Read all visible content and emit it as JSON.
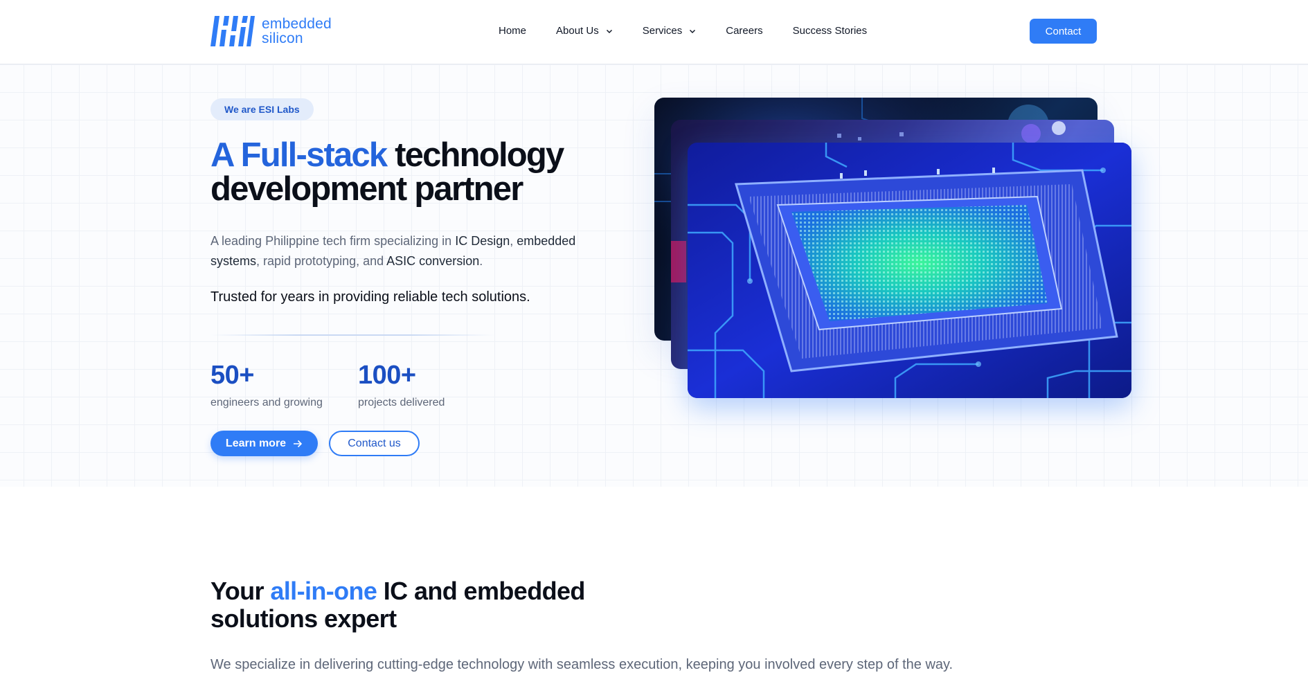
{
  "brand": {
    "name_line1": "embedded",
    "name_line2": "silicon",
    "color": "#2f7cf6"
  },
  "nav": {
    "items": [
      {
        "label": "Home",
        "dropdown": false
      },
      {
        "label": "About Us",
        "dropdown": true
      },
      {
        "label": "Services",
        "dropdown": true
      },
      {
        "label": "Careers",
        "dropdown": false
      },
      {
        "label": "Success Stories",
        "dropdown": false
      }
    ],
    "contact_label": "Contact"
  },
  "hero": {
    "badge": "We are ESI Labs",
    "title_accent": "A Full-stack",
    "title_rest": " technology development partner",
    "lead": {
      "t1": "A leading Philippine tech firm specializing in ",
      "b1": "IC Design",
      "t2": ", ",
      "b2": "embedded systems",
      "t3": ", rapid prototyping, and ",
      "b3": "ASIC conversion",
      "t4": "."
    },
    "trusted": "Trusted for years in providing reliable tech solutions.",
    "stats": [
      {
        "value": "50+",
        "label": "engineers and growing"
      },
      {
        "value": "100+",
        "label": "projects delivered"
      }
    ],
    "learn_more_label": "Learn more",
    "contact_us_label": "Contact us",
    "icons": {
      "learn_more": "arrow-right-icon"
    }
  },
  "section2": {
    "title_pre": "Your ",
    "title_accent": "all-in-one",
    "title_post": " IC and embedded solutions expert",
    "text": "We specialize in delivering cutting-edge technology with seamless execution, keeping you involved every step of the way."
  },
  "colors": {
    "accent": "#2f7cf6",
    "title_accent": "#2464dc",
    "stat_number": "#1b4fc2"
  }
}
